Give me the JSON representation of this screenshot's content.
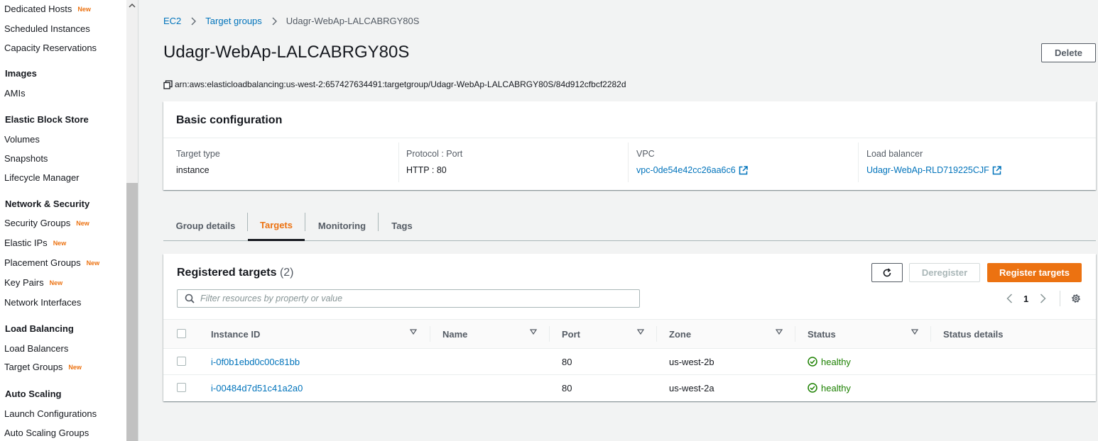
{
  "sidebar": {
    "items": [
      {
        "label": "Dedicated Hosts",
        "new": "New"
      },
      {
        "label": "Scheduled Instances"
      },
      {
        "label": "Capacity Reservations"
      },
      {
        "heading": "Images"
      },
      {
        "label": "AMIs"
      },
      {
        "heading": "Elastic Block Store"
      },
      {
        "label": "Volumes"
      },
      {
        "label": "Snapshots"
      },
      {
        "label": "Lifecycle Manager"
      },
      {
        "heading": "Network & Security"
      },
      {
        "label": "Security Groups",
        "new": "New"
      },
      {
        "label": "Elastic IPs",
        "new": "New"
      },
      {
        "label": "Placement Groups",
        "new": "New"
      },
      {
        "label": "Key Pairs",
        "new": "New"
      },
      {
        "label": "Network Interfaces"
      },
      {
        "heading": "Load Balancing"
      },
      {
        "label": "Load Balancers"
      },
      {
        "label": "Target Groups",
        "new": "New"
      },
      {
        "heading": "Auto Scaling"
      },
      {
        "label": "Launch Configurations"
      },
      {
        "label": "Auto Scaling Groups"
      }
    ]
  },
  "breadcrumb": {
    "root": "EC2",
    "parent": "Target groups",
    "current": "Udagr-WebAp-LALCABRGY80S"
  },
  "page": {
    "title": "Udagr-WebAp-LALCABRGY80S",
    "delete_label": "Delete",
    "arn": "arn:aws:elasticloadbalancing:us-west-2:657427634491:targetgroup/Udagr-WebAp-LALCABRGY80S/84d912cfbcf2282d"
  },
  "basic_config": {
    "title": "Basic configuration",
    "target_type_label": "Target type",
    "target_type_value": "instance",
    "protocol_label": "Protocol : Port",
    "protocol_value": "HTTP : 80",
    "vpc_label": "VPC",
    "vpc_value": "vpc-0de54e42cc26aa6c6",
    "lb_label": "Load balancer",
    "lb_value": "Udagr-WebAp-RLD719225CJF"
  },
  "tabs": [
    {
      "label": "Group details"
    },
    {
      "label": "Targets"
    },
    {
      "label": "Monitoring"
    },
    {
      "label": "Tags"
    }
  ],
  "active_tab": "Targets",
  "registered_targets": {
    "title": "Registered targets",
    "count": "(2)",
    "deregister_label": "Deregister",
    "register_label": "Register targets",
    "filter_placeholder": "Filter resources by property or value",
    "page": "1",
    "columns": [
      "Instance ID",
      "Name",
      "Port",
      "Zone",
      "Status",
      "Status details"
    ],
    "rows": [
      {
        "instance_id": "i-0f0b1ebd0c00c81bb",
        "name": "",
        "port": "80",
        "zone": "us-west-2b",
        "status": "healthy",
        "status_details": ""
      },
      {
        "instance_id": "i-00484d7d51c41a2a0",
        "name": "",
        "port": "80",
        "zone": "us-west-2a",
        "status": "healthy",
        "status_details": ""
      }
    ]
  },
  "colors": {
    "accent": "#ec7211",
    "link": "#0073bb",
    "healthy": "#1d8102"
  }
}
